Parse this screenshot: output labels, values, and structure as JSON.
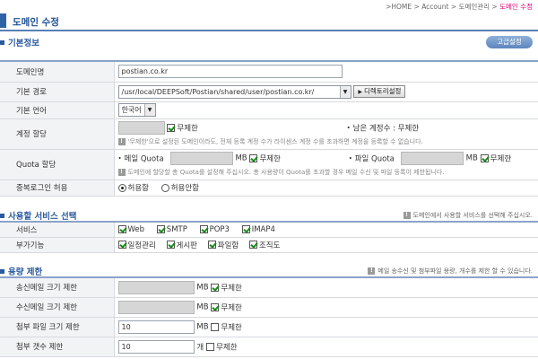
{
  "breadcrumb": {
    "home": ">HOME",
    "account": "Account",
    "domain_mgmt": "도메인관리",
    "current": "도메인 수정"
  },
  "page_title": "도메인 수정",
  "advanced_button": "고급설정",
  "basic": {
    "title": "기본정보",
    "domain_name": {
      "label": "도메인명",
      "value": "postian.co.kr"
    },
    "base_path": {
      "label": "기본 경로",
      "value": "/usr/local/DEEPSoft/Postian/shared/user/postian.co.kr/",
      "dir_button": "디렉토리설정"
    },
    "language": {
      "label": "기본 언어",
      "value": "한국어"
    },
    "accounts": {
      "label": "계정 할당",
      "unlimited": "무제한",
      "remaining": "남은 계정수 : 무제한",
      "note": "'무제한'으로 설정된 도메인이라도, 전체 등록 계정 수가 라이센스 계정 수를 초과하면 계정을 등록할 수 없습니다."
    },
    "quota": {
      "label": "Quota 할당",
      "mail_label": "메일 Quota",
      "file_label": "파일 Quota",
      "unit": "MB",
      "unlimited": "무제한",
      "note": "도메인에 할당할 총 Quota를 설정해 주십시오. 총 사용량이 Quota를 초과할 경우 메일 수신 및 파일 등록이 제한됩니다."
    },
    "dup_login": {
      "label": "중복로그인 허용",
      "allow": "허용함",
      "deny": "허용안함",
      "selected": "allow"
    }
  },
  "services": {
    "title": "사용할 서비스 선택",
    "note": "도메인에서 사용할 서비스를 선택해 주십시오.",
    "service": {
      "label": "서비스",
      "items": [
        {
          "name": "Web",
          "checked": true
        },
        {
          "name": "SMTP",
          "checked": true
        },
        {
          "name": "POP3",
          "checked": true
        },
        {
          "name": "IMAP4",
          "checked": true
        }
      ]
    },
    "addons": {
      "label": "부가기능",
      "items": [
        {
          "name": "일정관리",
          "checked": true
        },
        {
          "name": "게시판",
          "checked": true
        },
        {
          "name": "파일함",
          "checked": true
        },
        {
          "name": "조직도",
          "checked": true
        }
      ]
    }
  },
  "capacity": {
    "title": "용량 제한",
    "note": "메일 송수신 및 첨부파일 용량, 개수를 제한 할 수 있습니다.",
    "send_size": {
      "label": "송신메일 크기 제한",
      "unit": "MB",
      "unlimited": "무제한",
      "value": "",
      "checked": true
    },
    "recv_size": {
      "label": "수신메일 크기 제한",
      "unit": "MB",
      "unlimited": "무제한",
      "value": "",
      "checked": true
    },
    "attach_size": {
      "label": "첨부 파일 크기 제한",
      "unit": "MB",
      "unlimited": "무제한",
      "value": "10",
      "checked": false
    },
    "attach_count": {
      "label": "첨부 갯수 제한",
      "unit": "개",
      "unlimited": "무제한",
      "value": "10",
      "checked": false
    }
  }
}
